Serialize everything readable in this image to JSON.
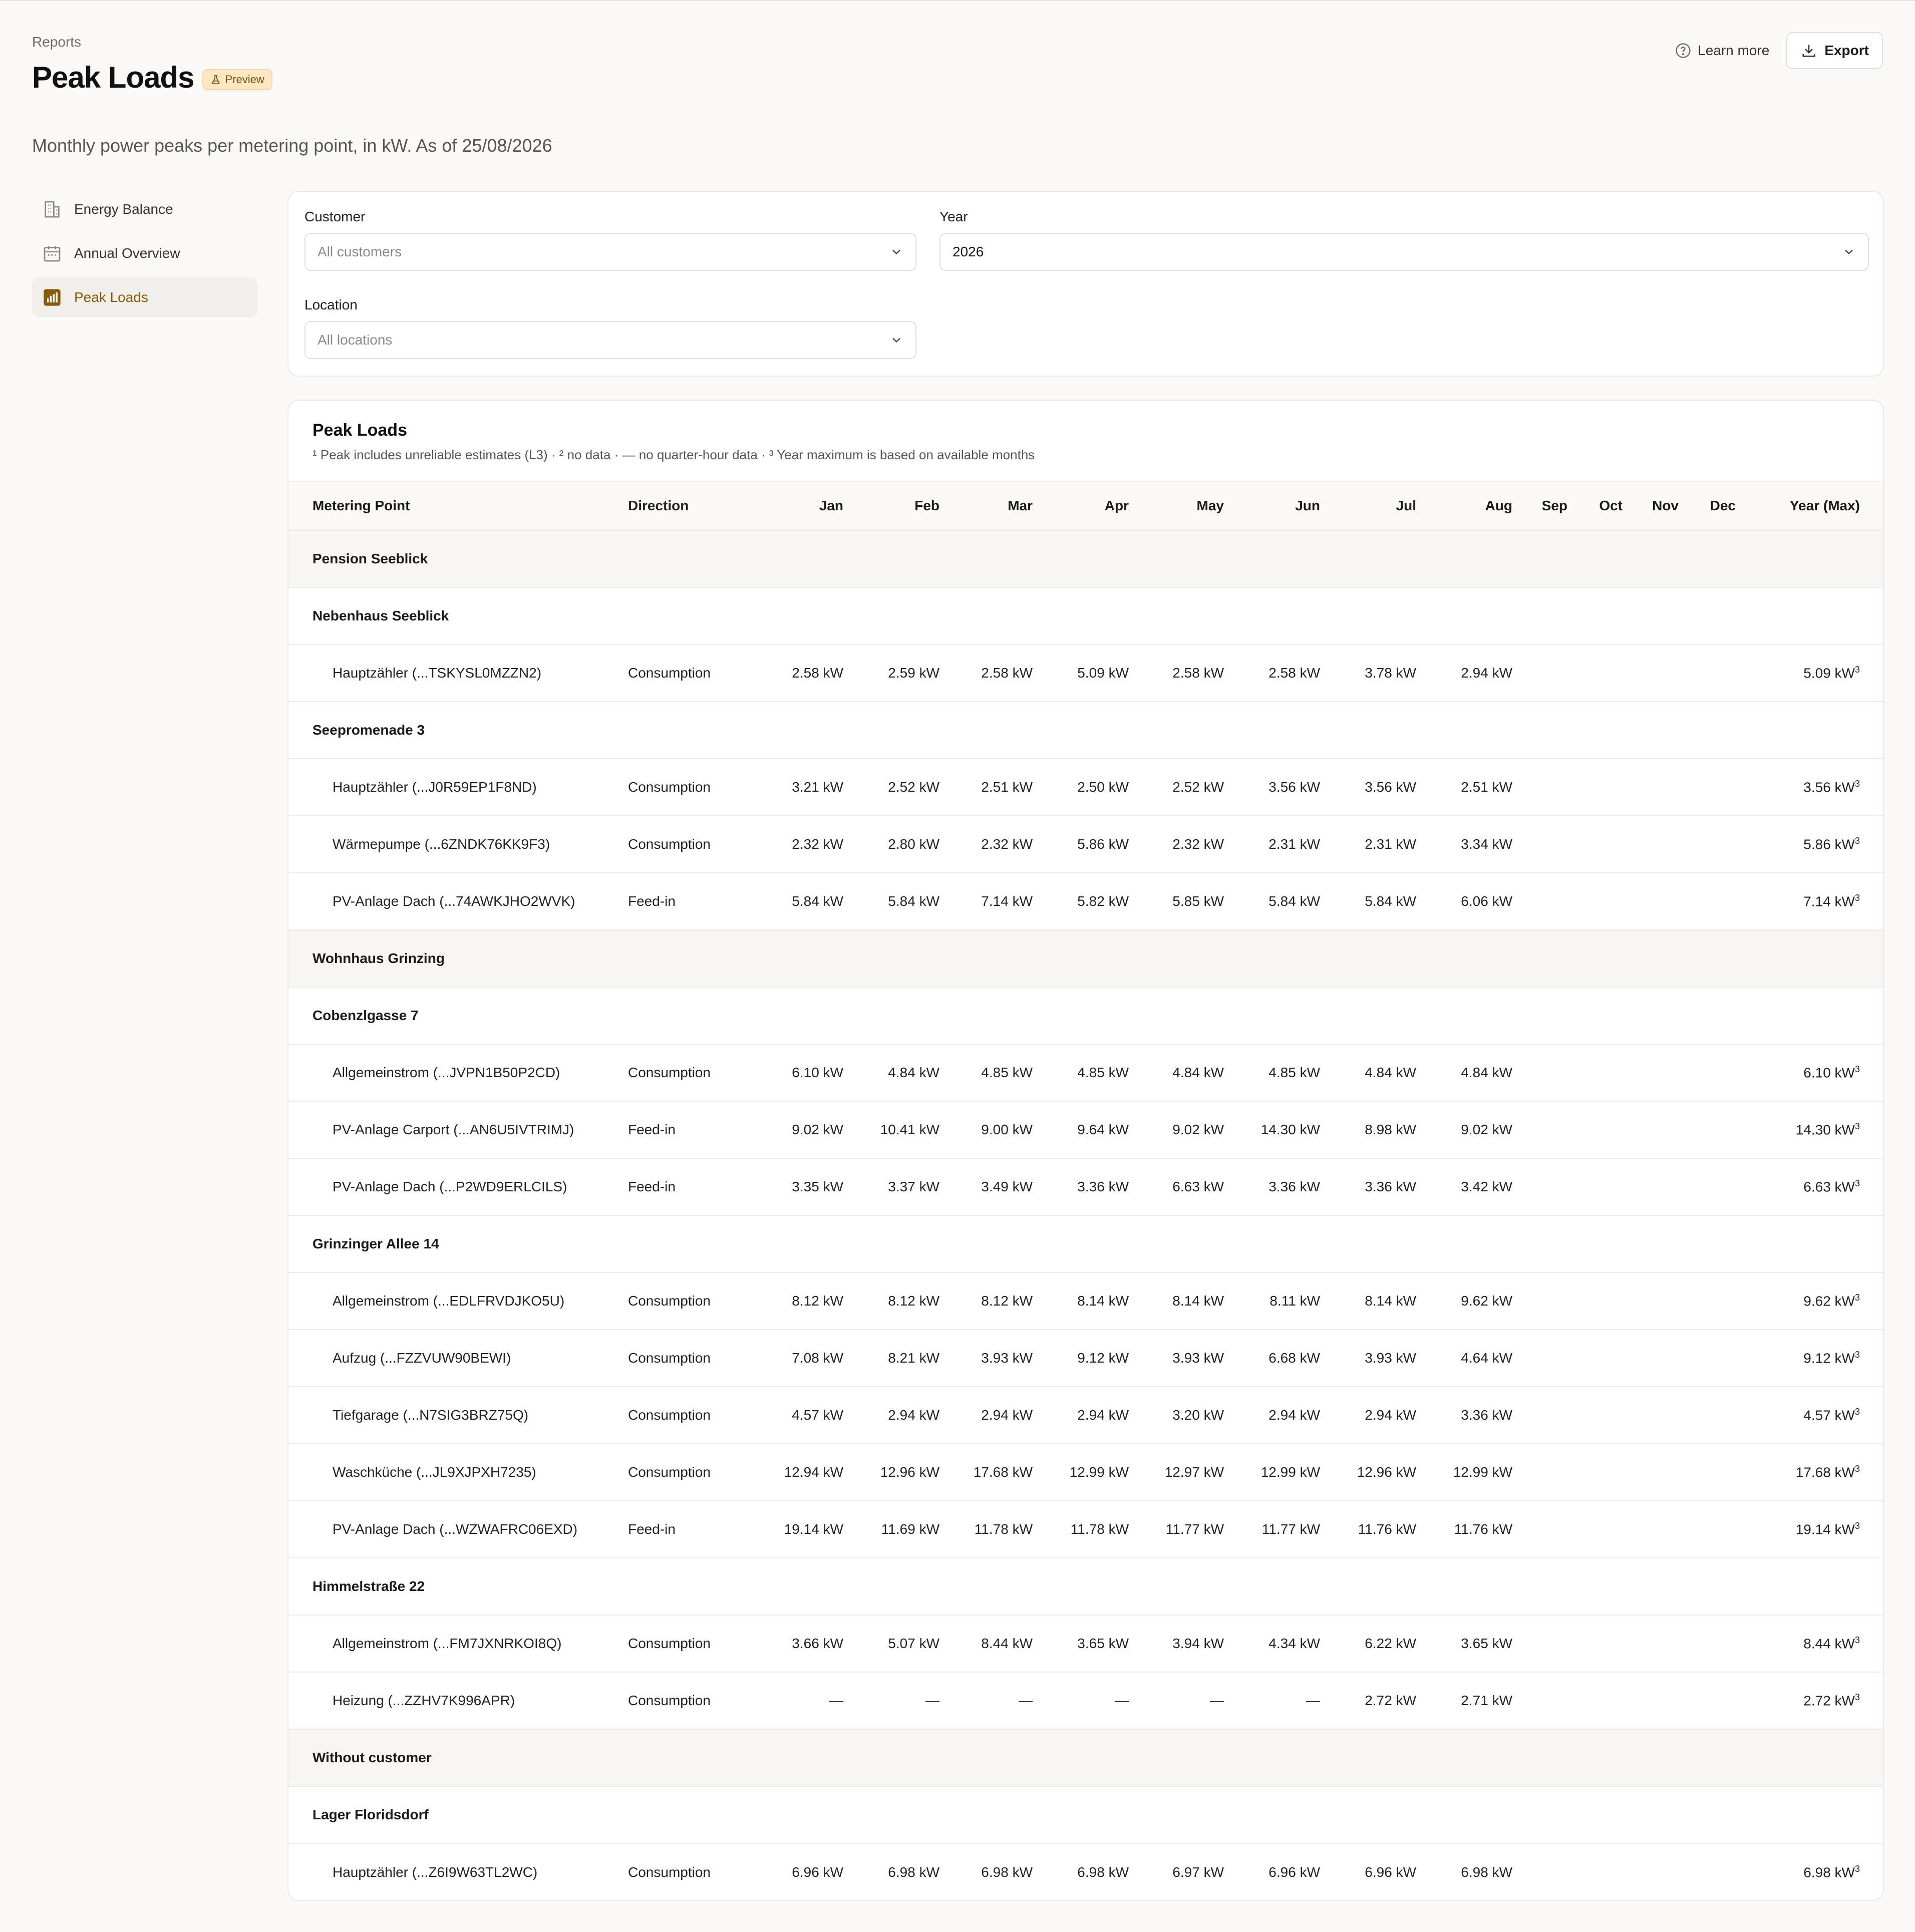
{
  "header": {
    "breadcrumb": "Reports",
    "title": "Peak Loads",
    "badge": "Preview",
    "learn_more": "Learn more",
    "export": "Export",
    "subtitle": "Monthly power peaks per metering point, in kW. As of 25/08/2026"
  },
  "sidebar": {
    "items": [
      {
        "label": "Energy Balance",
        "icon": "building-icon",
        "active": false
      },
      {
        "label": "Annual Overview",
        "icon": "calendar-icon",
        "active": false
      },
      {
        "label": "Peak Loads",
        "icon": "bar-chart-icon",
        "active": true
      }
    ]
  },
  "filters": {
    "customer": {
      "label": "Customer",
      "placeholder": "All customers"
    },
    "year": {
      "label": "Year",
      "value": "2026"
    },
    "location": {
      "label": "Location",
      "placeholder": "All locations"
    }
  },
  "table": {
    "title": "Peak Loads",
    "note": "¹ Peak includes unreliable estimates (L3) · ² no data · — no quarter-hour data · ³ Year maximum is based on available months",
    "columns": [
      "Metering Point",
      "Direction",
      "Jan",
      "Feb",
      "Mar",
      "Apr",
      "May",
      "Jun",
      "Jul",
      "Aug",
      "Sep",
      "Oct",
      "Nov",
      "Dec",
      "Year (Max)"
    ],
    "rows": [
      {
        "type": "customer",
        "label": "Pension Seeblick"
      },
      {
        "type": "location",
        "label": "Nebenhaus Seeblick"
      },
      {
        "type": "meter",
        "label": "Hauptzähler (...TSKYSL0MZZN2)",
        "direction": "Consumption",
        "values": [
          "2.58 kW",
          "2.59 kW",
          "2.58 kW",
          "5.09 kW",
          "2.58 kW",
          "2.58 kW",
          "3.78 kW",
          "2.94 kW",
          "",
          "",
          "",
          ""
        ],
        "max": "5.09 kW",
        "sup": "3"
      },
      {
        "type": "location",
        "label": "Seepromenade 3"
      },
      {
        "type": "meter",
        "label": "Hauptzähler (...J0R59EP1F8ND)",
        "direction": "Consumption",
        "values": [
          "3.21 kW",
          "2.52 kW",
          "2.51 kW",
          "2.50 kW",
          "2.52 kW",
          "3.56 kW",
          "3.56 kW",
          "2.51 kW",
          "",
          "",
          "",
          ""
        ],
        "max": "3.56 kW",
        "sup": "3"
      },
      {
        "type": "meter",
        "label": "Wärmepumpe (...6ZNDK76KK9F3)",
        "direction": "Consumption",
        "values": [
          "2.32 kW",
          "2.80 kW",
          "2.32 kW",
          "5.86 kW",
          "2.32 kW",
          "2.31 kW",
          "2.31 kW",
          "3.34 kW",
          "",
          "",
          "",
          ""
        ],
        "max": "5.86 kW",
        "sup": "3"
      },
      {
        "type": "meter",
        "label": "PV-Anlage Dach (...74AWKJHO2WVK)",
        "direction": "Feed-in",
        "values": [
          "5.84 kW",
          "5.84 kW",
          "7.14 kW",
          "5.82 kW",
          "5.85 kW",
          "5.84 kW",
          "5.84 kW",
          "6.06 kW",
          "",
          "",
          "",
          ""
        ],
        "max": "7.14 kW",
        "sup": "3"
      },
      {
        "type": "customer",
        "label": "Wohnhaus Grinzing"
      },
      {
        "type": "location",
        "label": "Cobenzlgasse 7"
      },
      {
        "type": "meter",
        "label": "Allgemeinstrom (...JVPN1B50P2CD)",
        "direction": "Consumption",
        "values": [
          "6.10 kW",
          "4.84 kW",
          "4.85 kW",
          "4.85 kW",
          "4.84 kW",
          "4.85 kW",
          "4.84 kW",
          "4.84 kW",
          "",
          "",
          "",
          ""
        ],
        "max": "6.10 kW",
        "sup": "3"
      },
      {
        "type": "meter",
        "label": "PV-Anlage Carport (...AN6U5IVTRIMJ)",
        "direction": "Feed-in",
        "values": [
          "9.02 kW",
          "10.41 kW",
          "9.00 kW",
          "9.64 kW",
          "9.02 kW",
          "14.30 kW",
          "8.98 kW",
          "9.02 kW",
          "",
          "",
          "",
          ""
        ],
        "max": "14.30 kW",
        "sup": "3"
      },
      {
        "type": "meter",
        "label": "PV-Anlage Dach (...P2WD9ERLCILS)",
        "direction": "Feed-in",
        "values": [
          "3.35 kW",
          "3.37 kW",
          "3.49 kW",
          "3.36 kW",
          "6.63 kW",
          "3.36 kW",
          "3.36 kW",
          "3.42 kW",
          "",
          "",
          "",
          ""
        ],
        "max": "6.63 kW",
        "sup": "3"
      },
      {
        "type": "location",
        "label": "Grinzinger Allee 14"
      },
      {
        "type": "meter",
        "label": "Allgemeinstrom (...EDLFRVDJKO5U)",
        "direction": "Consumption",
        "values": [
          "8.12 kW",
          "8.12 kW",
          "8.12 kW",
          "8.14 kW",
          "8.14 kW",
          "8.11 kW",
          "8.14 kW",
          "9.62 kW",
          "",
          "",
          "",
          ""
        ],
        "max": "9.62 kW",
        "sup": "3"
      },
      {
        "type": "meter",
        "label": "Aufzug (...FZZVUW90BEWI)",
        "direction": "Consumption",
        "values": [
          "7.08 kW",
          "8.21 kW",
          "3.93 kW",
          "9.12 kW",
          "3.93 kW",
          "6.68 kW",
          "3.93 kW",
          "4.64 kW",
          "",
          "",
          "",
          ""
        ],
        "max": "9.12 kW",
        "sup": "3"
      },
      {
        "type": "meter",
        "label": "Tiefgarage (...N7SIG3BRZ75Q)",
        "direction": "Consumption",
        "values": [
          "4.57 kW",
          "2.94 kW",
          "2.94 kW",
          "2.94 kW",
          "3.20 kW",
          "2.94 kW",
          "2.94 kW",
          "3.36 kW",
          "",
          "",
          "",
          ""
        ],
        "max": "4.57 kW",
        "sup": "3"
      },
      {
        "type": "meter",
        "label": "Waschküche (...JL9XJPXH7235)",
        "direction": "Consumption",
        "values": [
          "12.94 kW",
          "12.96 kW",
          "17.68 kW",
          "12.99 kW",
          "12.97 kW",
          "12.99 kW",
          "12.96 kW",
          "12.99 kW",
          "",
          "",
          "",
          ""
        ],
        "max": "17.68 kW",
        "sup": "3"
      },
      {
        "type": "meter",
        "label": "PV-Anlage Dach (...WZWAFRC06EXD)",
        "direction": "Feed-in",
        "values": [
          "19.14 kW",
          "11.69 kW",
          "11.78 kW",
          "11.78 kW",
          "11.77 kW",
          "11.77 kW",
          "11.76 kW",
          "11.76 kW",
          "",
          "",
          "",
          ""
        ],
        "max": "19.14 kW",
        "sup": "3"
      },
      {
        "type": "location",
        "label": "Himmelstraße 22"
      },
      {
        "type": "meter",
        "label": "Allgemeinstrom (...FM7JXNRKOI8Q)",
        "direction": "Consumption",
        "values": [
          "3.66 kW",
          "5.07 kW",
          "8.44 kW",
          "3.65 kW",
          "3.94 kW",
          "4.34 kW",
          "6.22 kW",
          "3.65 kW",
          "",
          "",
          "",
          ""
        ],
        "max": "8.44 kW",
        "sup": "3"
      },
      {
        "type": "meter",
        "label": "Heizung (...ZZHV7K996APR)",
        "direction": "Consumption",
        "values": [
          "—",
          "—",
          "—",
          "—",
          "—",
          "—",
          "2.72 kW",
          "2.71 kW",
          "",
          "",
          "",
          ""
        ],
        "max": "2.72 kW",
        "sup": "3"
      },
      {
        "type": "customer",
        "label": "Without customer"
      },
      {
        "type": "location",
        "label": "Lager Floridsdorf"
      },
      {
        "type": "meter",
        "label": "Hauptzähler (...Z6I9W63TL2WC)",
        "direction": "Consumption",
        "values": [
          "6.96 kW",
          "6.98 kW",
          "6.98 kW",
          "6.98 kW",
          "6.97 kW",
          "6.96 kW",
          "6.96 kW",
          "6.98 kW",
          "",
          "",
          "",
          ""
        ],
        "max": "6.98 kW",
        "sup": "3"
      }
    ]
  }
}
